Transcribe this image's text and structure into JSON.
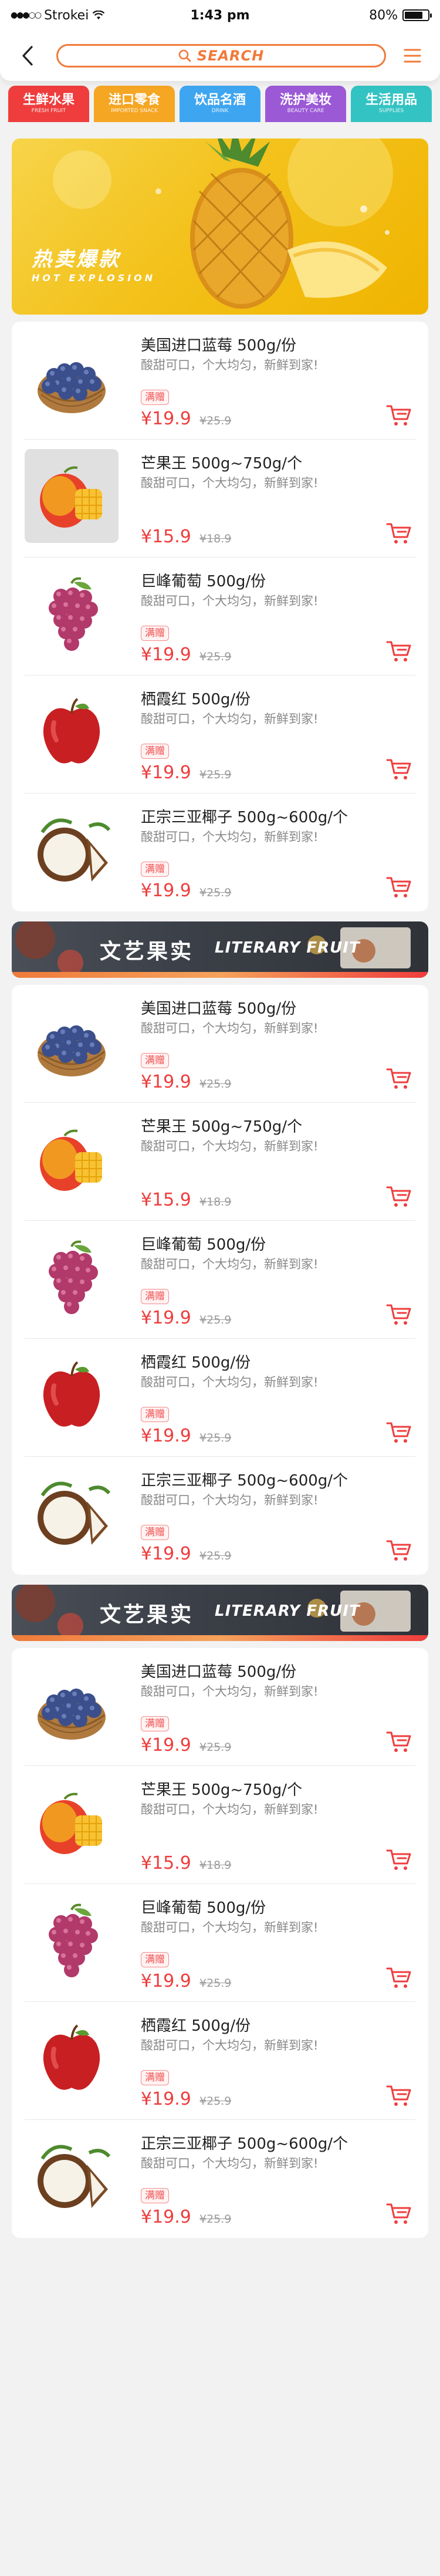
{
  "status": {
    "carrier": "Strokei",
    "time": "1:43 pm",
    "battery": "80%",
    "battery_level": 0.8
  },
  "nav": {
    "search_text": "SEARCH"
  },
  "colors": {
    "accent": "#f07a3a",
    "price": "#ef3d3d",
    "tag": "#f05050"
  },
  "categories": [
    {
      "cn": "生鲜水果",
      "en": "FRESH FRUIT",
      "color": "#ef3d3d"
    },
    {
      "cn": "进口零食",
      "en": "IMPORTED SNACK",
      "color": "#f5a623"
    },
    {
      "cn": "饮品名酒",
      "en": "DRINK",
      "color": "#3ea6f0"
    },
    {
      "cn": "洗护美妆",
      "en": "BEAUTY CARE",
      "color": "#9b59d6"
    },
    {
      "cn": "生活用品",
      "en": "SUPPLIES",
      "color": "#34c3c3"
    }
  ],
  "hero": {
    "title": "热卖爆款",
    "subtitle": "HOT EXPLOSION"
  },
  "section_banner": {
    "title": "文艺果实",
    "subtitle": "LITERARY FRUIT"
  },
  "section1": {
    "products": [
      {
        "name": "美国进口蓝莓 500g/份",
        "desc": "酸甜可口，个大均匀，新鲜到家!",
        "tag": "满赠",
        "price": "¥19.9",
        "old_price": "¥25.9",
        "image": "blueberry"
      },
      {
        "name": "芒果王 500g~750g/个",
        "desc": "酸甜可口，个大均匀，新鲜到家!",
        "tag": "",
        "price": "¥15.9",
        "old_price": "¥18.9",
        "image": "mango"
      },
      {
        "name": "巨峰葡萄 500g/份",
        "desc": "酸甜可口，个大均匀，新鲜到家!",
        "tag": "满赠",
        "price": "¥19.9",
        "old_price": "¥25.9",
        "image": "grape"
      },
      {
        "name": "栖霞红 500g/份",
        "desc": "酸甜可口，个大均匀，新鲜到家!",
        "tag": "满赠",
        "price": "¥19.9",
        "old_price": "¥25.9",
        "image": "apple"
      },
      {
        "name": "正宗三亚椰子 500g~600g/个",
        "desc": "酸甜可口，个大均匀，新鲜到家!",
        "tag": "满赠",
        "price": "¥19.9",
        "old_price": "¥25.9",
        "image": "coconut"
      }
    ]
  },
  "section2": {
    "products": [
      {
        "name": "美国进口蓝莓 500g/份",
        "desc": "酸甜可口，个大均匀，新鲜到家!",
        "tag": "满赠",
        "price": "¥19.9",
        "old_price": "¥25.9",
        "image": "blueberry"
      },
      {
        "name": "芒果王 500g~750g/个",
        "desc": "酸甜可口，个大均匀，新鲜到家!",
        "tag": "",
        "price": "¥15.9",
        "old_price": "¥18.9",
        "image": "mango"
      },
      {
        "name": "巨峰葡萄 500g/份",
        "desc": "酸甜可口，个大均匀，新鲜到家!",
        "tag": "满赠",
        "price": "¥19.9",
        "old_price": "¥25.9",
        "image": "grape"
      },
      {
        "name": "栖霞红 500g/份",
        "desc": "酸甜可口，个大均匀，新鲜到家!",
        "tag": "满赠",
        "price": "¥19.9",
        "old_price": "¥25.9",
        "image": "apple"
      },
      {
        "name": "正宗三亚椰子 500g~600g/个",
        "desc": "酸甜可口，个大均匀，新鲜到家!",
        "tag": "满赠",
        "price": "¥19.9",
        "old_price": "¥25.9",
        "image": "coconut"
      }
    ]
  },
  "section3": {
    "products": [
      {
        "name": "美国进口蓝莓 500g/份",
        "desc": "酸甜可口，个大均匀，新鲜到家!",
        "tag": "满赠",
        "price": "¥19.9",
        "old_price": "¥25.9",
        "image": "blueberry"
      },
      {
        "name": "芒果王 500g~750g/个",
        "desc": "酸甜可口，个大均匀，新鲜到家!",
        "tag": "",
        "price": "¥15.9",
        "old_price": "¥18.9",
        "image": "mango"
      },
      {
        "name": "巨峰葡萄 500g/份",
        "desc": "酸甜可口，个大均匀，新鲜到家!",
        "tag": "满赠",
        "price": "¥19.9",
        "old_price": "¥25.9",
        "image": "grape"
      },
      {
        "name": "栖霞红 500g/份",
        "desc": "酸甜可口，个大均匀，新鲜到家!",
        "tag": "满赠",
        "price": "¥19.9",
        "old_price": "¥25.9",
        "image": "apple"
      },
      {
        "name": "正宗三亚椰子 500g~600g/个",
        "desc": "酸甜可口，个大均匀，新鲜到家!",
        "tag": "满赠",
        "price": "¥19.9",
        "old_price": "¥25.9",
        "image": "coconut"
      }
    ]
  }
}
